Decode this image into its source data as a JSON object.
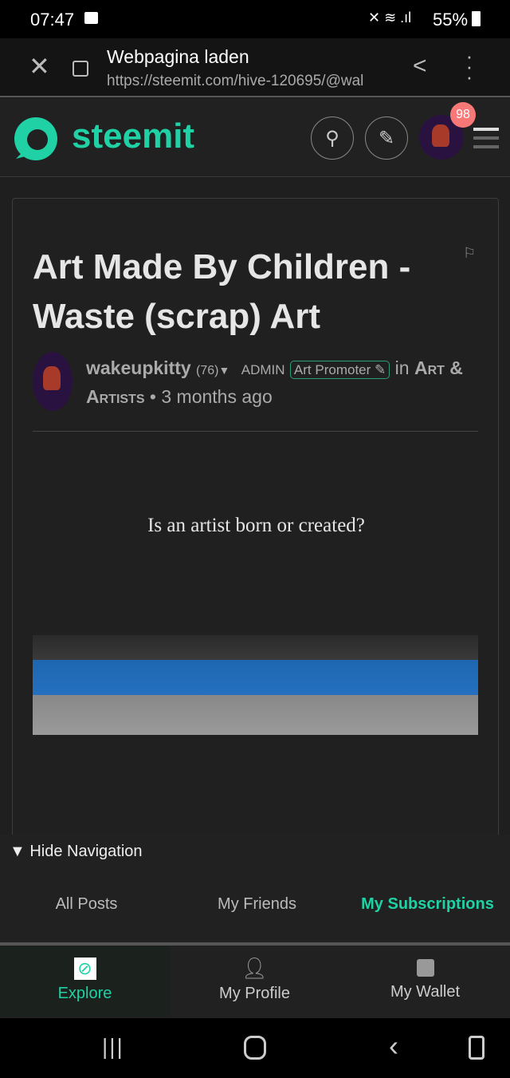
{
  "status_bar": {
    "time": "07:47",
    "battery": "55%"
  },
  "browser": {
    "title": "Webpagina laden",
    "url": "https://steemit.com/hive-120695/@wal"
  },
  "header": {
    "logo_text": "steemit",
    "notification_count": "98",
    "brand_color": "#1fd1a5"
  },
  "post": {
    "title": "Art Made By Children - Waste (scrap) Art",
    "author": "wakeupkitty",
    "reputation": "(76)",
    "role": "ADMIN",
    "badge": "Art Promoter",
    "in_label": "in",
    "community": "Art & Artists",
    "separator": "•",
    "time": "3 months ago",
    "body_text": "Is an artist born or created?"
  },
  "navigation": {
    "hide_label": "Hide Navigation",
    "tabs": [
      {
        "label": "All Posts"
      },
      {
        "label": "My Friends"
      },
      {
        "label": "My Subscriptions",
        "active": true
      }
    ],
    "bottom": [
      {
        "label": "Explore",
        "icon": "compass-icon",
        "active": true
      },
      {
        "label": "My Profile",
        "icon": "user-icon"
      },
      {
        "label": "My Wallet",
        "icon": "wallet-icon"
      }
    ]
  }
}
